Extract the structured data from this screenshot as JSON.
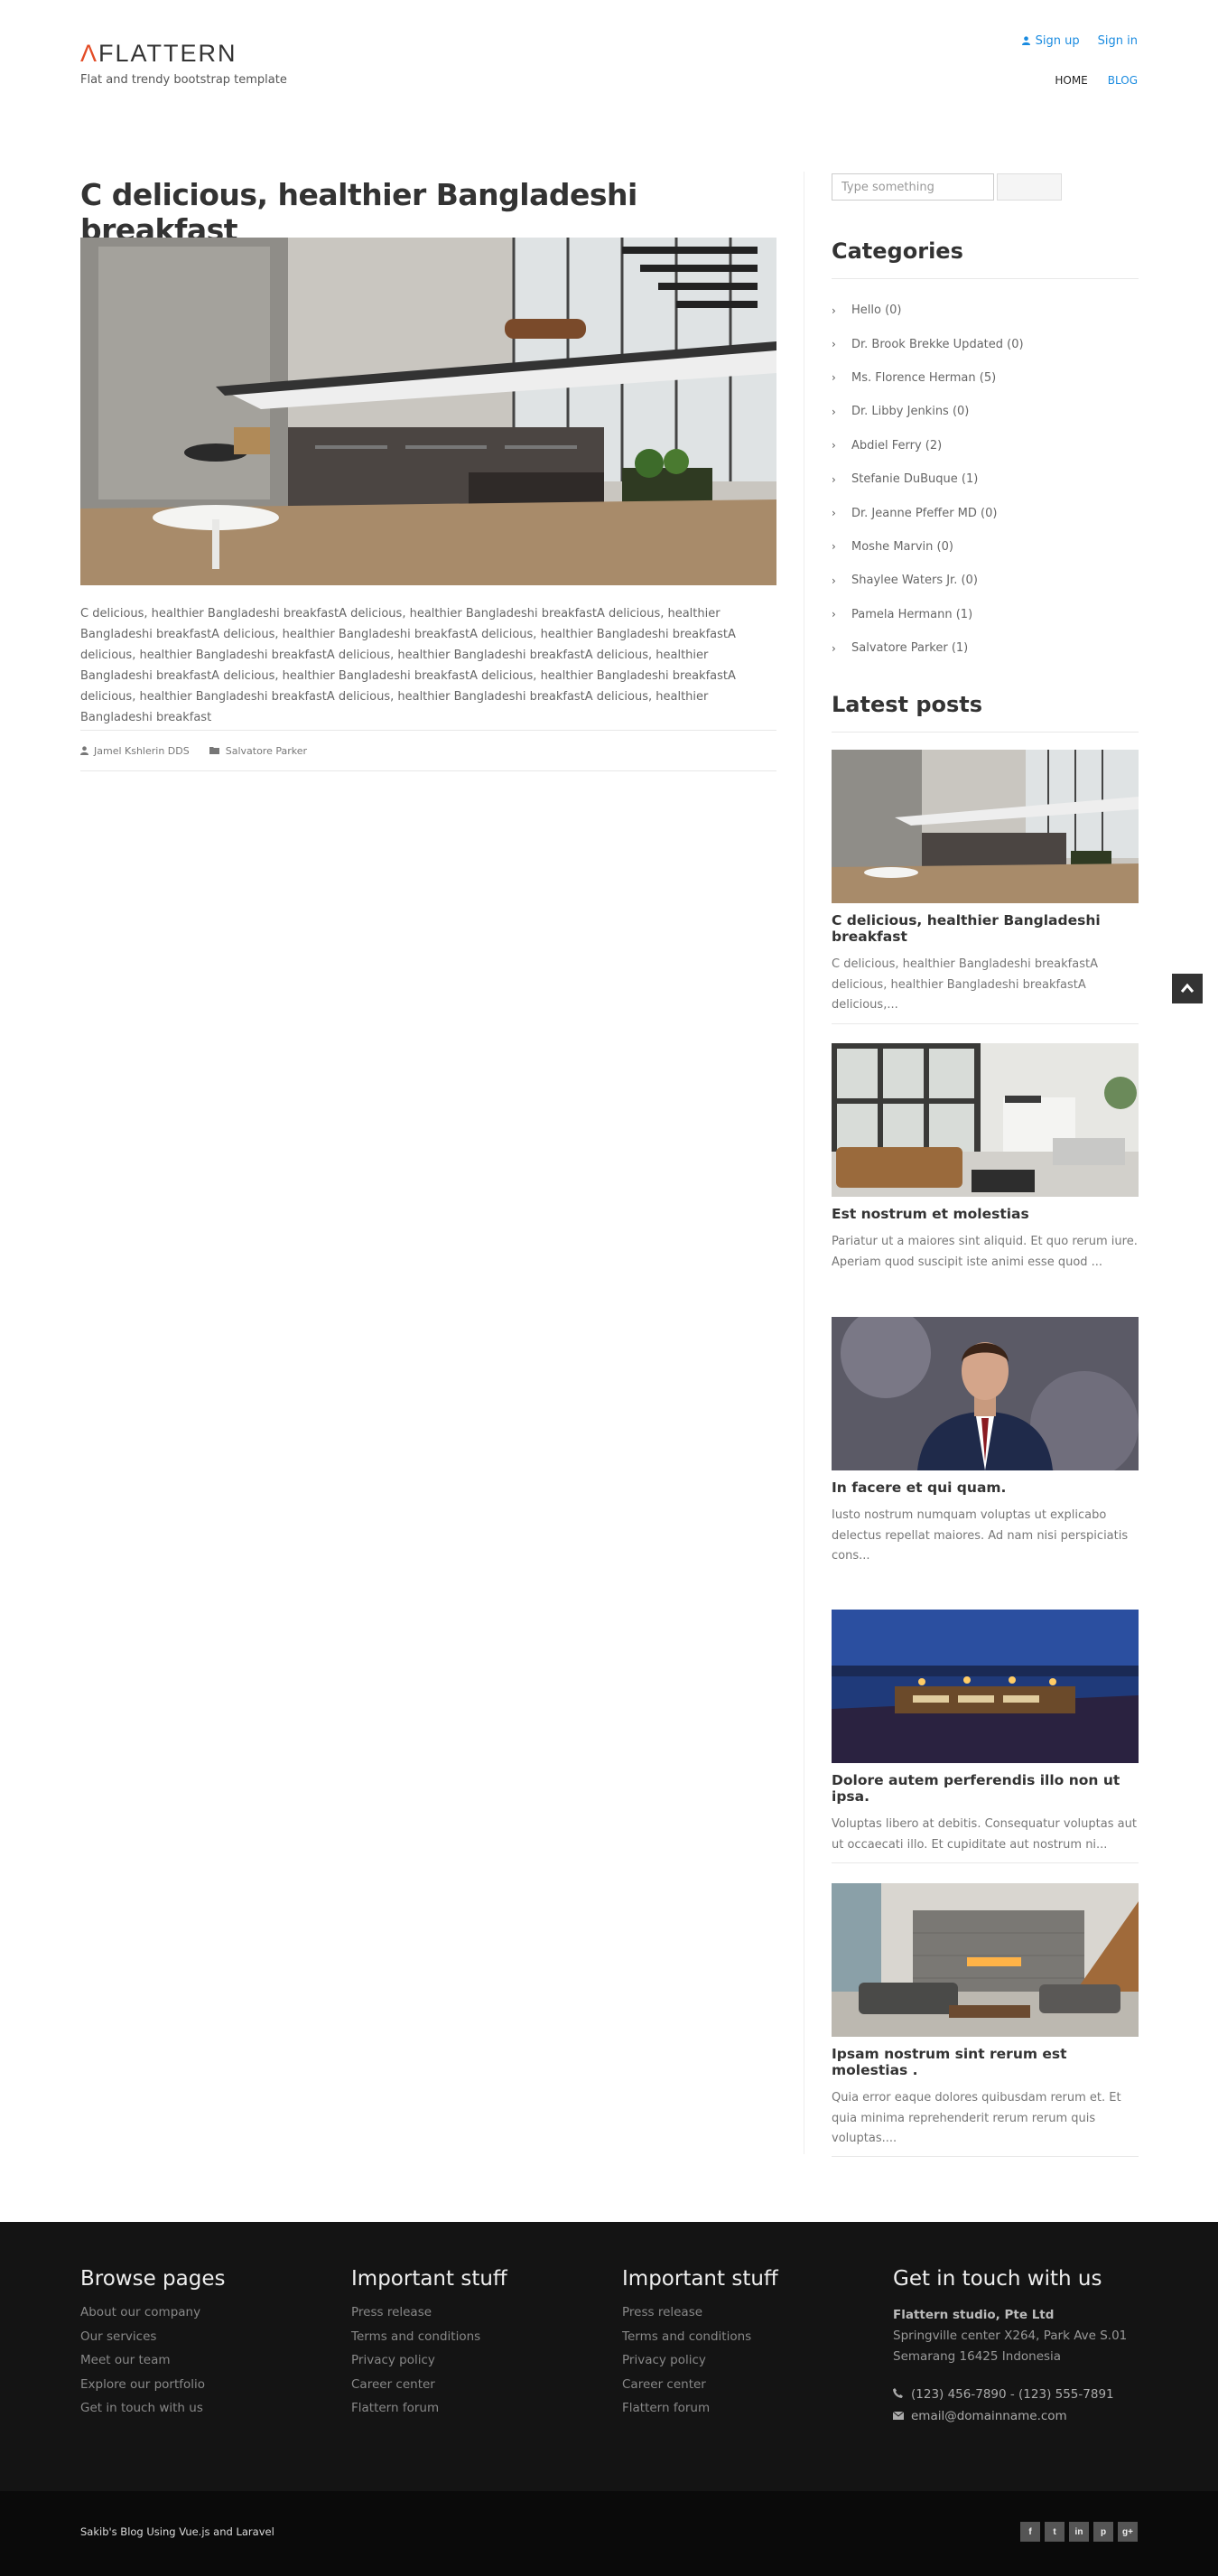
{
  "header": {
    "logo_mark": "Λ",
    "logo_text": "FLATTERN",
    "tagline": "Flat and trendy bootstrap template",
    "sign_up": "Sign up",
    "sign_in": "Sign in",
    "nav": [
      {
        "label": "HOME",
        "active": false
      },
      {
        "label": "BLOG",
        "active": true
      }
    ]
  },
  "article": {
    "title": "C delicious, healthier Bangladeshi breakfast",
    "body": "C delicious, healthier Bangladeshi breakfastA delicious, healthier Bangladeshi breakfastA delicious, healthier Bangladeshi breakfastA delicious, healthier Bangladeshi breakfastA delicious, healthier Bangladeshi breakfastA delicious, healthier Bangladeshi breakfastA delicious, healthier Bangladeshi breakfastA delicious, healthier Bangladeshi breakfastA delicious, healthier Bangladeshi breakfastA delicious, healthier Bangladeshi breakfastA delicious, healthier Bangladeshi breakfastA delicious, healthier Bangladeshi breakfastA delicious, healthier Bangladeshi breakfast",
    "author": "Jamel Kshlerin DDS",
    "category": "Salvatore Parker"
  },
  "sidebar": {
    "search_placeholder": "Type something",
    "categories_title": "Categories",
    "categories": [
      "Hello (0)",
      "Dr. Brook Brekke Updated (0)",
      "Ms. Florence Herman (5)",
      "Dr. Libby Jenkins (0)",
      "Abdiel Ferry (2)",
      "Stefanie DuBuque (1)",
      "Dr. Jeanne Pfeffer MD (0)",
      "Moshe Marvin (0)",
      "Shaylee Waters Jr. (0)",
      "Pamela Hermann (1)",
      "Salvatore Parker (1)"
    ],
    "latest_title": "Latest posts",
    "posts": [
      {
        "title": "C delicious, healthier Bangladeshi breakfast",
        "excerpt": "C delicious, healthier Bangladeshi breakfastA delicious, healthier Bangladeshi breakfastA delicious,..."
      },
      {
        "title": "Est nostrum et molestias",
        "excerpt": "Pariatur ut a maiores sint aliquid. Et quo rerum iure. Aperiam quod suscipit iste animi esse quod ..."
      },
      {
        "title": "In facere et qui quam.",
        "excerpt": "Iusto nostrum numquam voluptas ut explicabo delectus repellat maiores. Ad nam nisi perspiciatis cons..."
      },
      {
        "title": "Dolore autem perferendis illo non ut ipsa.",
        "excerpt": "Voluptas libero at debitis. Consequatur voluptas aut ut occaecati illo. Et cupiditate aut nostrum ni..."
      },
      {
        "title": "Ipsam nostrum sint rerum est molestias .",
        "excerpt": "Quia error eaque dolores quibusdam rerum et. Et quia minima reprehenderit rerum rerum quis voluptas...."
      }
    ]
  },
  "footer": {
    "col1": {
      "title": "Browse pages",
      "links": [
        "About our company",
        "Our services",
        "Meet our team",
        "Explore our portfolio",
        "Get in touch with us"
      ]
    },
    "col2": {
      "title": "Important stuff",
      "links": [
        "Press release",
        "Terms and conditions",
        "Privacy policy",
        "Career center",
        "Flattern forum"
      ]
    },
    "col3": {
      "title": "Important stuff",
      "links": [
        "Press release",
        "Terms and conditions",
        "Privacy policy",
        "Career center",
        "Flattern forum"
      ]
    },
    "col4": {
      "title": "Get in touch with us",
      "company": "Flattern studio, Pte Ltd",
      "address1": "Springville center X264, Park Ave S.01",
      "address2": "Semarang 16425 Indonesia",
      "phone": "(123) 456-7890 - (123) 555-7891",
      "email": "email@domainname.com"
    },
    "copyright": "Sakib's Blog Using Vue.js and Laravel",
    "social": [
      "f",
      "t",
      "in",
      "p",
      "g+"
    ]
  }
}
